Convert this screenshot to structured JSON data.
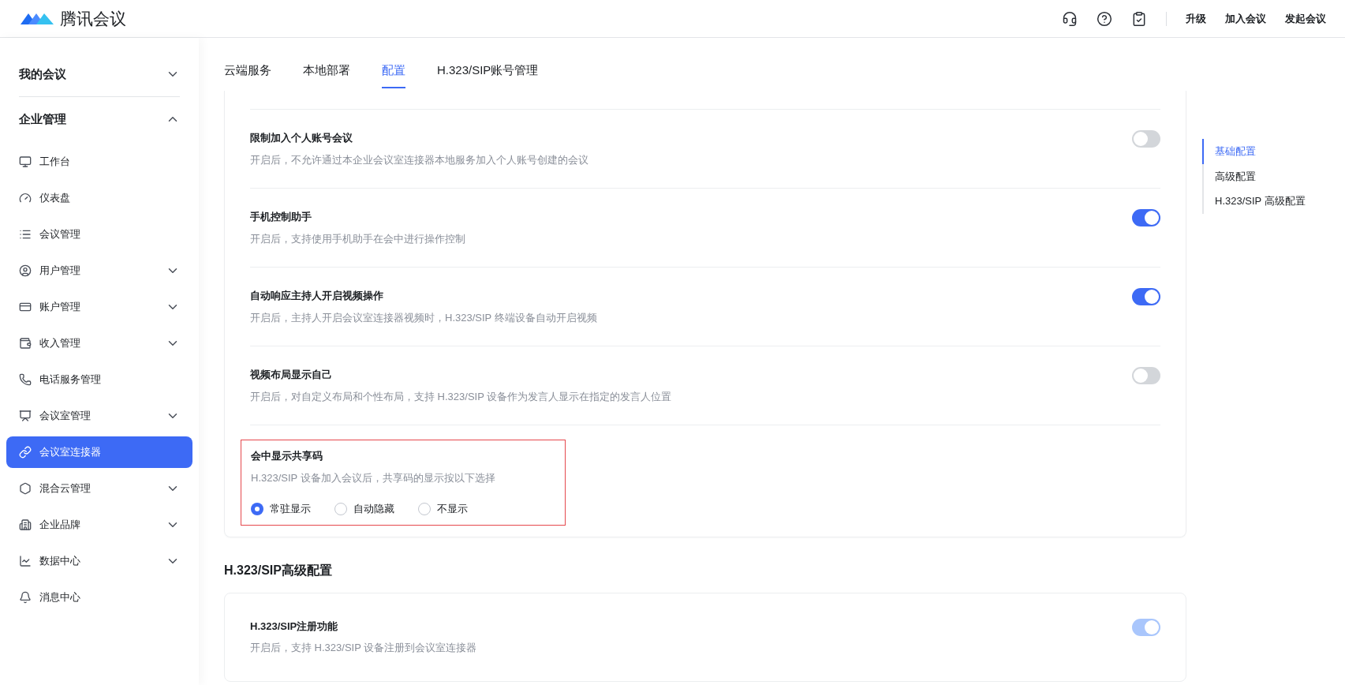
{
  "header": {
    "brand": "腾讯会议",
    "links": [
      "升级",
      "加入会议",
      "发起会议"
    ]
  },
  "sidebar": {
    "sections": [
      {
        "label": "我的会议",
        "expanded": false
      },
      {
        "label": "企业管理",
        "expanded": true,
        "children": [
          {
            "label": "工作台",
            "kind": "link",
            "selected": false
          },
          {
            "label": "仪表盘",
            "kind": "link",
            "selected": false
          },
          {
            "label": "会议管理",
            "kind": "link",
            "selected": false
          },
          {
            "label": "用户管理",
            "kind": "group",
            "selected": false
          },
          {
            "label": "账户管理",
            "kind": "group",
            "selected": false
          },
          {
            "label": "收入管理",
            "kind": "group",
            "selected": false
          },
          {
            "label": "电话服务管理",
            "kind": "link",
            "selected": false
          },
          {
            "label": "会议室管理",
            "kind": "group",
            "selected": false
          },
          {
            "label": "会议室连接器",
            "kind": "link",
            "selected": true
          },
          {
            "label": "混合云管理",
            "kind": "group",
            "selected": false
          },
          {
            "label": "企业品牌",
            "kind": "group",
            "selected": false
          },
          {
            "label": "数据中心",
            "kind": "group",
            "selected": false
          },
          {
            "label": "消息中心",
            "kind": "link",
            "selected": false
          }
        ]
      }
    ]
  },
  "tabs": [
    {
      "label": "云端服务",
      "selected": false
    },
    {
      "label": "本地部署",
      "selected": false
    },
    {
      "label": "配置",
      "selected": true
    },
    {
      "label": "H.323/SIP账号管理",
      "selected": false
    }
  ],
  "settings": [
    {
      "kind": "toggle",
      "title": "限制加入个人账号会议",
      "description": "开启后，不允许通过本企业会议室连接器本地服务加入个人账号创建的会议",
      "on": false,
      "disabled": false
    },
    {
      "kind": "toggle",
      "title": "手机控制助手",
      "description": "开启后，支持使用手机助手在会中进行操作控制",
      "on": true,
      "disabled": false
    },
    {
      "kind": "toggle",
      "title": "自动响应主持人开启视频操作",
      "description": "开启后，主持人开启会议室连接器视频时，H.323/SIP 终端设备自动开启视频",
      "on": true,
      "disabled": false
    },
    {
      "kind": "toggle",
      "title": "视频布局显示自己",
      "description": "开启后，对自定义布局和个性布局，支持 H.323/SIP 设备作为发言人显示在指定的发言人位置",
      "on": false,
      "disabled": false
    },
    {
      "kind": "radio",
      "title": "会中显示共享码",
      "description": "H.323/SIP 设备加入会议后，共享码的显示按以下选择",
      "highlighted": true,
      "options": [
        {
          "label": "常驻显示",
          "selected": true
        },
        {
          "label": "自动隐藏",
          "selected": false
        },
        {
          "label": "不显示",
          "selected": false
        }
      ]
    }
  ],
  "advanced": {
    "heading": "H.323/SIP高级配置",
    "settings": [
      {
        "kind": "toggle",
        "title": "H.323/SIP注册功能",
        "description": "开启后，支持 H.323/SIP 设备注册到会议室连接器",
        "on": true,
        "disabled": true
      }
    ]
  },
  "anchors": [
    {
      "label": "基础配置",
      "selected": true
    },
    {
      "label": "高级配置",
      "selected": false
    },
    {
      "label": "H.323/SIP 高级配置",
      "selected": false
    }
  ]
}
